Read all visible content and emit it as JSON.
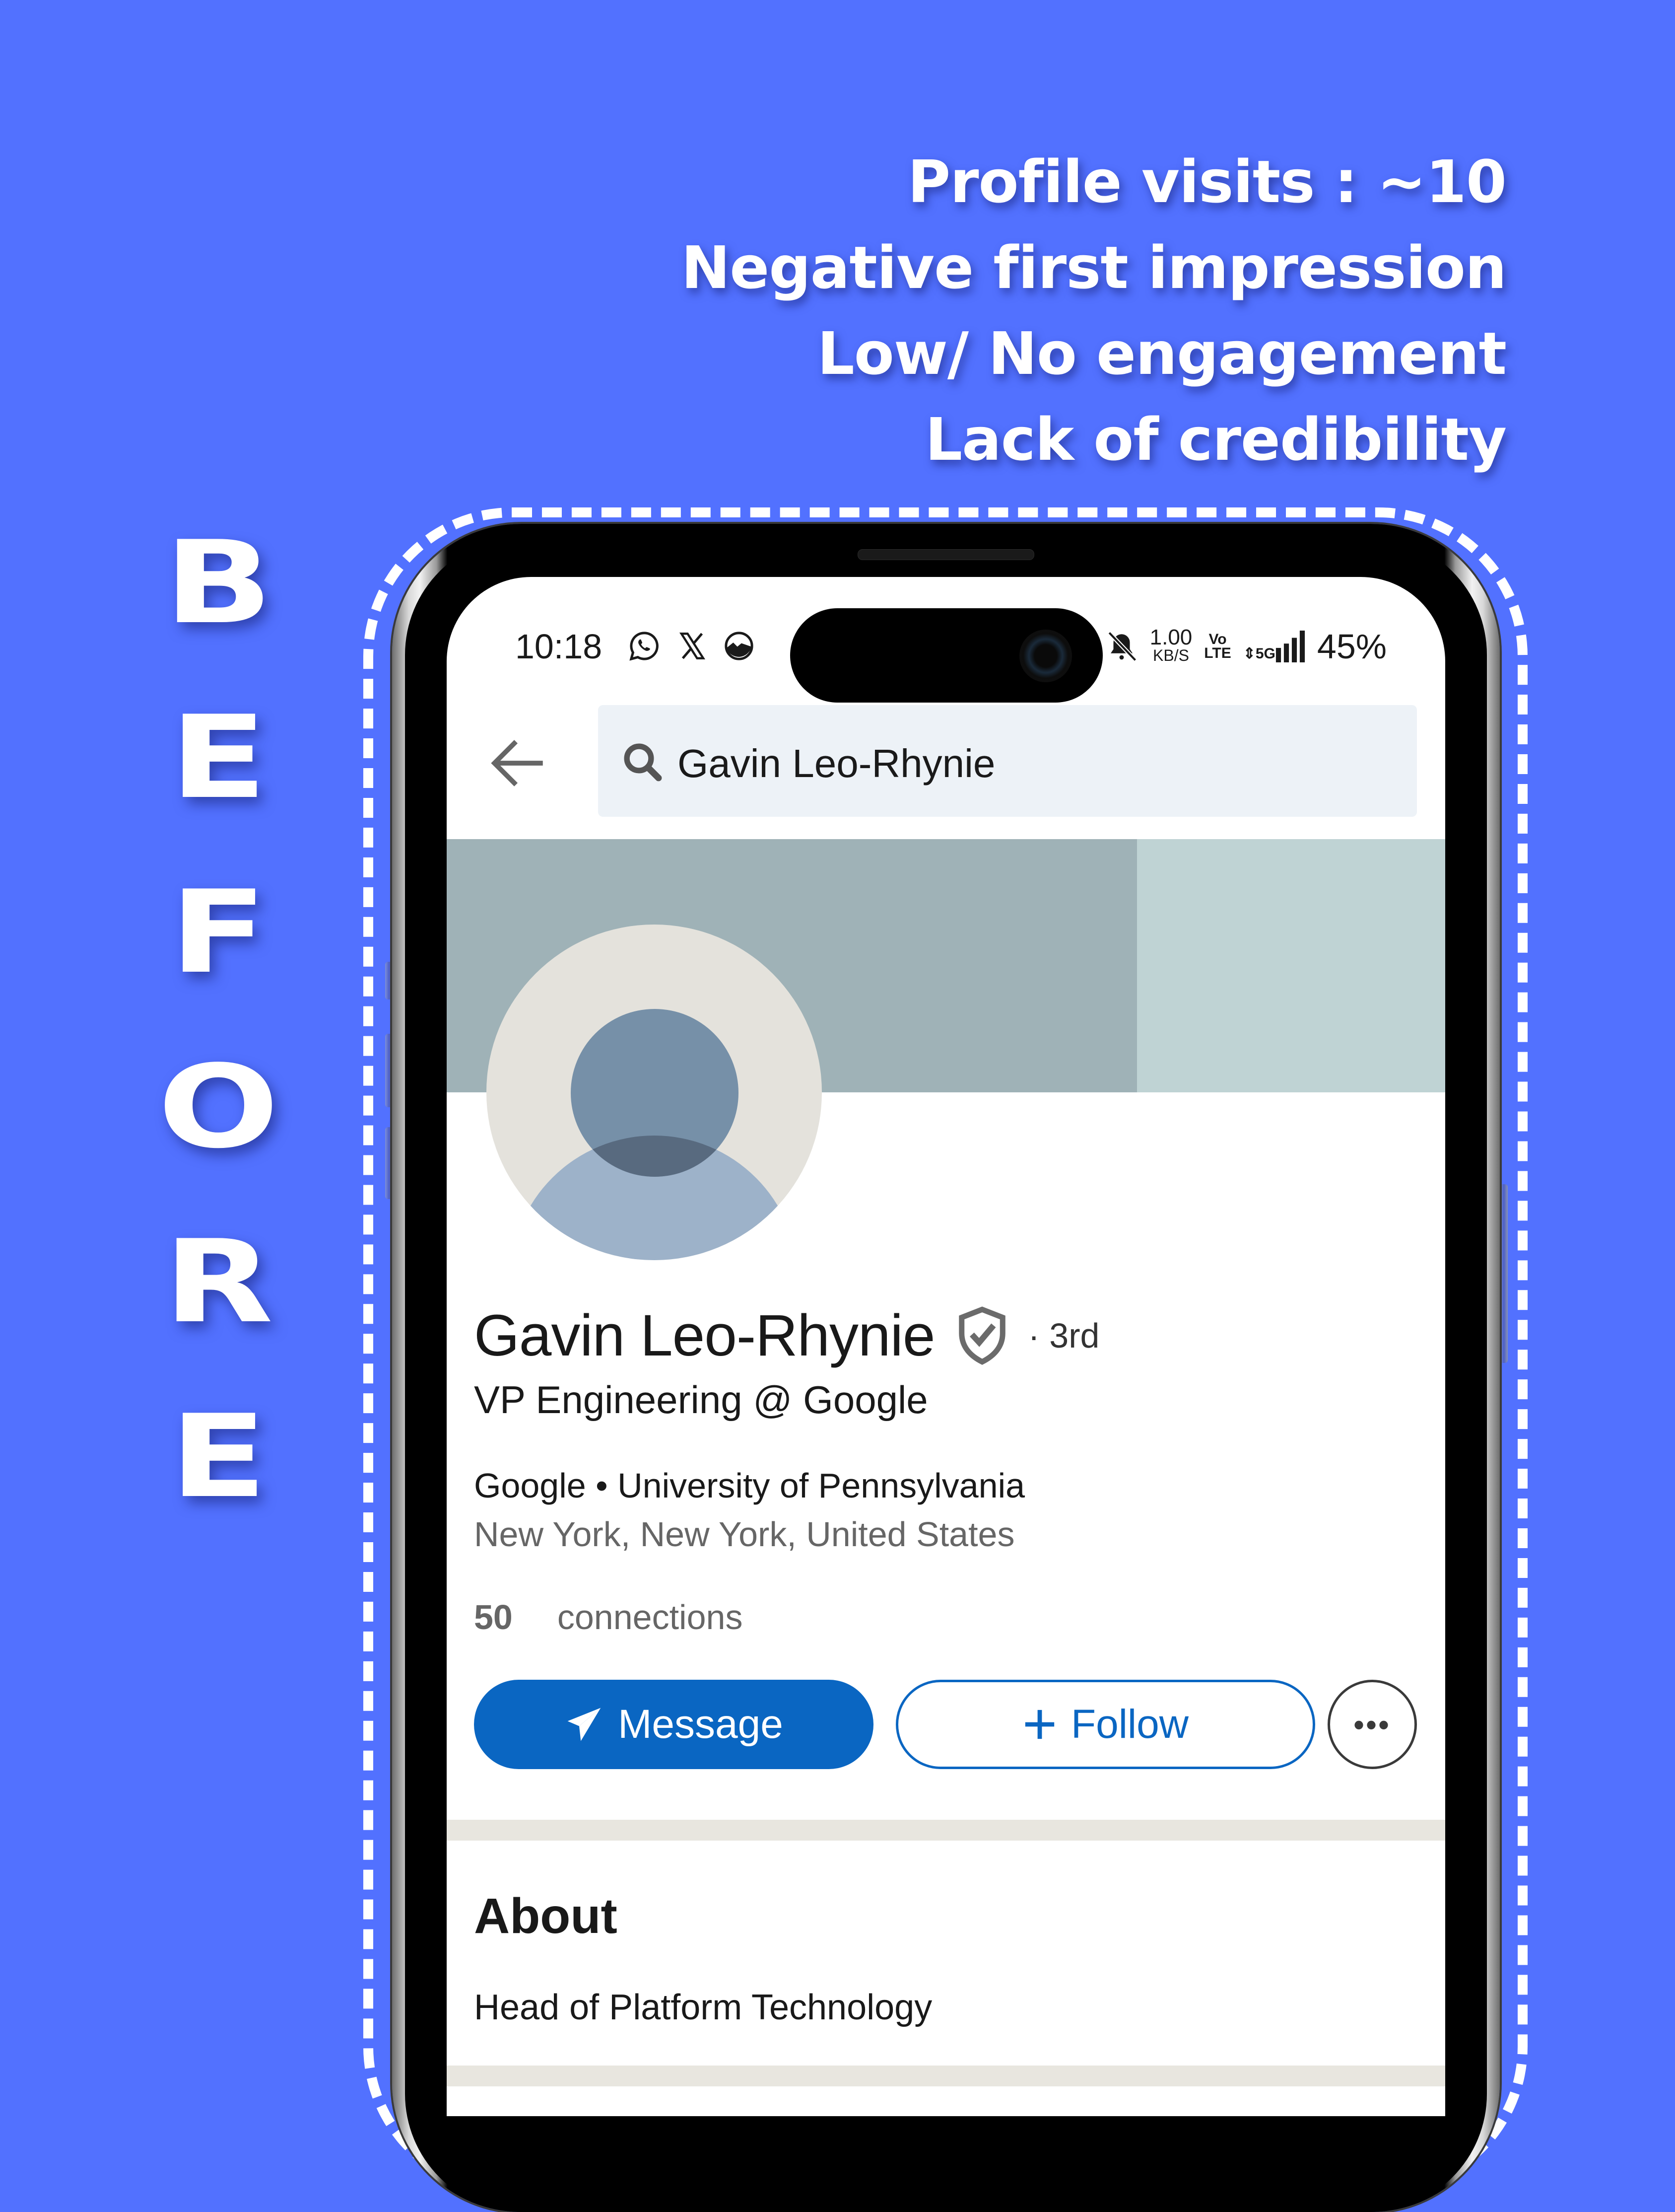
{
  "overlay": {
    "headlines": [
      "Profile visits : ~10",
      "Negative first impression",
      "Low/ No engagement",
      "Lack of credibility"
    ],
    "vertical_label_letters": [
      "B",
      "E",
      "F",
      "O",
      "R",
      "E"
    ],
    "background_color": "#5271ff"
  },
  "status_bar": {
    "time": "10:18",
    "left_icons": [
      "whatsapp-icon",
      "x-icon",
      "gallery-sync-icon"
    ],
    "network_speed_value": "1.00",
    "network_speed_unit": "KB/S",
    "volte_top": "Vo",
    "volte_bottom": "LTE",
    "network_type": "5G",
    "battery": "45%"
  },
  "search": {
    "query": "Gavin Leo-Rhynie"
  },
  "profile": {
    "name": "Gavin Leo-Rhynie",
    "connection_degree": "· 3rd",
    "headline": "VP Engineering @ Google",
    "company_and_school": "Google • University of Pennsylvania",
    "location": "New York, New York, United States",
    "connections_count": "50",
    "connections_label": "connections"
  },
  "actions": {
    "message_label": "Message",
    "follow_label": "Follow",
    "more_label": "•••"
  },
  "about": {
    "title": "About",
    "text": "Head of Platform Technology"
  },
  "colors": {
    "primary_blue": "#0a66c2",
    "banner": "#9fb2b7",
    "banner_light": "#bfd3d4",
    "search_bg": "#edf2f7"
  }
}
